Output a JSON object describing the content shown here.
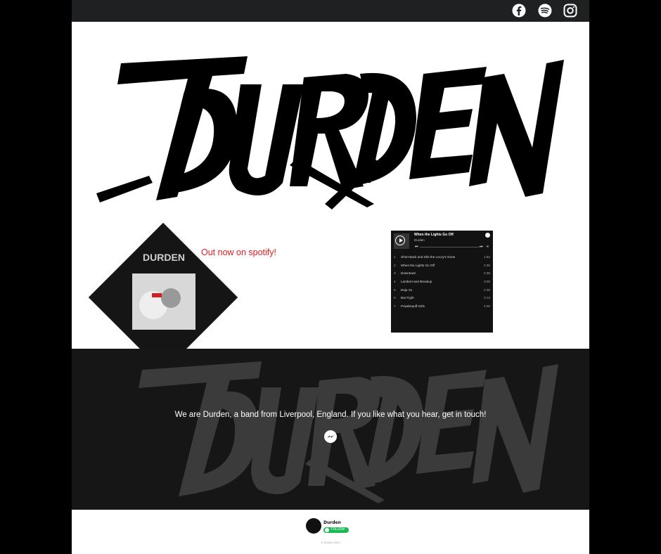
{
  "social": {
    "facebook_icon": "facebook-icon",
    "spotify_icon": "spotify-icon",
    "instagram_icon": "instagram-icon"
  },
  "logo_text": "DURDEN",
  "promo": {
    "text": "Out now on spotify!",
    "color": "#e31b1b"
  },
  "player": {
    "title": "When the Lights Go Off",
    "artist": "Durden",
    "tracks": [
      {
        "num": "1",
        "title": "Short Back and Shit the Leccy's Gone",
        "duration": "1:52"
      },
      {
        "num": "2",
        "title": "When the Lights Go Off",
        "duration": "2:39"
      },
      {
        "num": "3",
        "title": "Downtown",
        "duration": "2:38"
      },
      {
        "num": "4",
        "title": "Lambert and Breakup",
        "duration": "3:09"
      },
      {
        "num": "5",
        "title": "Deja Vu",
        "duration": "2:39"
      },
      {
        "num": "6",
        "title": "Bar Fight",
        "duration": "3:13"
      },
      {
        "num": "7",
        "title": "Powderpuff Girls",
        "duration": "4:00"
      }
    ]
  },
  "about": {
    "text": "We are Durden, a band from Liverpool, England. If you like what you hear, get in touch!"
  },
  "footer": {
    "name": "Durden",
    "follow_label": "FOLLOW",
    "copyright": "© Durden 2020"
  },
  "colors": {
    "topbar": "#1f2021",
    "spotify_green": "#1db954",
    "banner": "#161616"
  }
}
